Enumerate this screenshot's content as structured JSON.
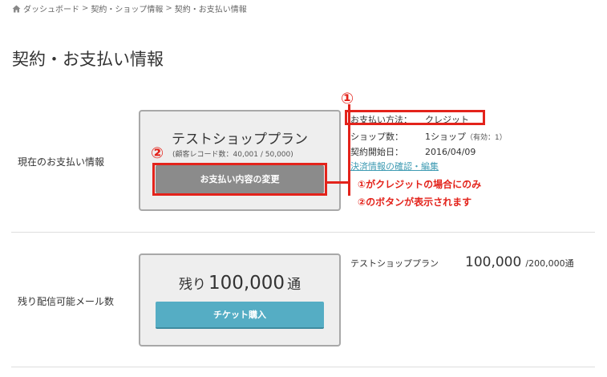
{
  "breadcrumb": {
    "items": [
      "ダッシュボード",
      "契約・ショップ情報",
      "契約・お支払い情報"
    ],
    "separator": ">"
  },
  "page_title": "契約・お支払い情報",
  "payment_section": {
    "label": "現在のお支払い情報",
    "plan_name": "テストショッププラン",
    "plan_sub": "(顧客レコード数：40,001 / 50,000)",
    "change_button": "お支払い内容の変更",
    "info": [
      {
        "key": "お支払い方法：",
        "value": "クレジット",
        "note": ""
      },
      {
        "key": "ショップ数：",
        "value": "1ショップ",
        "note": "（有効：1）"
      },
      {
        "key": "契約開始日：",
        "value": "2016/04/09",
        "note": ""
      }
    ],
    "payment_link": "決済情報の確認・編集"
  },
  "annotations": {
    "marker1": "①",
    "marker2": "②",
    "note_line1": "①がクレジットの場合にのみ",
    "note_line2": "②のボタンが表示されます",
    "color": "#e3231b"
  },
  "mail_section": {
    "label": "残り配信可能メール数",
    "remain_prefix": "残り",
    "remain_count": "100,000",
    "remain_unit": "通",
    "ticket_button": "チケット購入",
    "plan_name": "テストショッププラン",
    "count_current": "100,000",
    "count_total": "/200,000通"
  },
  "colors": {
    "ticket_button": "#55adc4",
    "change_button": "#8b8b8b",
    "link": "#3f9bb3"
  }
}
